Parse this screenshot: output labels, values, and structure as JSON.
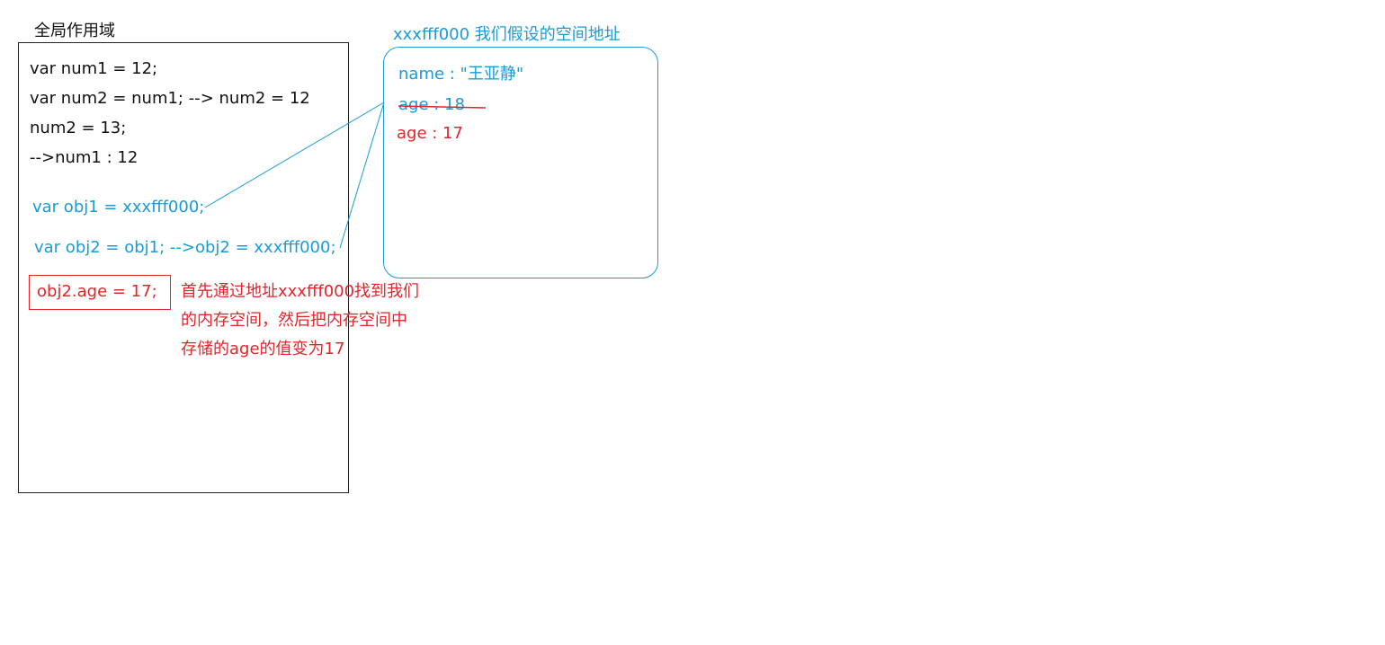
{
  "scope": {
    "title": "全局作用域",
    "lines": [
      "var num1 = 12;",
      "var num2 = num1; --> num2 = 12",
      "num2 = 13;",
      "-->num1 : 12"
    ],
    "obj1_line": "var obj1 = xxxfff000;",
    "obj2_line": "var obj2 = obj1;  -->obj2 = xxxfff000;",
    "assign_line": "obj2.age = 17;"
  },
  "heap": {
    "title": "xxxfff000 我们假设的空间地址",
    "name_line": "name : \"王亚静\"",
    "old_age_line": "age : 18",
    "new_age_line": "age : 17"
  },
  "note": {
    "lines": [
      "首先通过地址xxxfff000找到我们",
      "的内存空间，然后把内存空间中",
      "存储的age的值变为17"
    ]
  },
  "colors": {
    "blue": "#1a9bd7",
    "red": "#e3242b",
    "black": "#111111"
  }
}
